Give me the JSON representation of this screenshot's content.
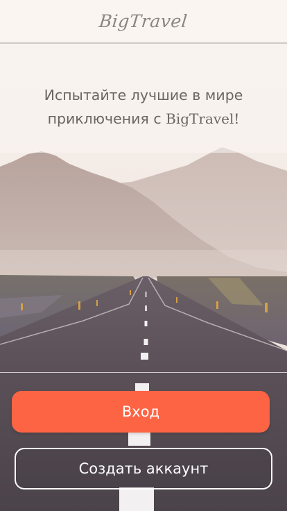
{
  "header": {
    "logo_text": "BigTravel"
  },
  "hero": {
    "tagline_part1": "Испытайте лучшие в мире",
    "tagline_part2": "приключения с ",
    "tagline_brand": "BigTravel!",
    "image_description": "road-through-mountains-photo"
  },
  "actions": {
    "login_label": "Вход",
    "signup_label": "Создать аккаунт"
  },
  "colors": {
    "accent": "#fd6444",
    "text_muted": "#6b6561",
    "logo": "#8a8580"
  }
}
